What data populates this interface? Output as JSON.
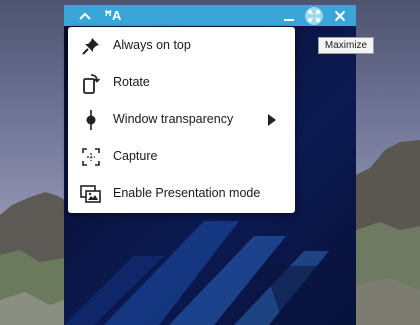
{
  "titlebar": {
    "font_label": "ꟸA",
    "icons": [
      "chevron-up-icon",
      "font-size-icon",
      "minimize-icon",
      "maximize-icon",
      "close-icon"
    ],
    "accent_color": "#3aa6d8"
  },
  "tooltip": {
    "text": "Maximize"
  },
  "menu": {
    "items": [
      {
        "label": "Always on top",
        "icon": "pin-icon"
      },
      {
        "label": "Rotate",
        "icon": "rotate-icon"
      },
      {
        "label": "Window transparency",
        "icon": "transparency-icon",
        "has_submenu": true
      },
      {
        "label": "Capture",
        "icon": "capture-icon"
      },
      {
        "label": "Enable Presentation mode",
        "icon": "presentation-mode-icon"
      }
    ]
  }
}
